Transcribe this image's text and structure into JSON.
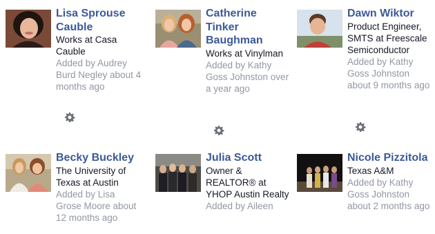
{
  "people": [
    {
      "name": "Lisa Sprouse Cauble",
      "work": "Works at Casa Cauble",
      "added": "Added by Audrey Burd Negley about 4 months ago"
    },
    {
      "name": "Catherine Tinker Baughman",
      "work": "Works at Vinylman",
      "added": "Added by Kathy Goss Johnston over a year ago"
    },
    {
      "name": "Dawn Wiktor",
      "work": "Product Engineer, SMTS at Freescale Semiconductor",
      "added": "Added by Kathy Goss Johnston about 9 months ago"
    },
    {
      "name": "Becky Buckley",
      "work": "The University of Texas at Austin",
      "added": "Added by Lisa Grose Moore about 12 months ago"
    },
    {
      "name": "Julia Scott",
      "work": "Owner & REALTOR® at YHOP Austin Realty",
      "added": "Added by Aileen"
    },
    {
      "name": "Nicole Pizzitola",
      "work": "Texas A&M",
      "added": "Added by Kathy Goss Johnston about 2 months ago"
    }
  ],
  "icons": {
    "settings": "gear-icon"
  },
  "colors": {
    "name_link": "#3b5998",
    "body_text": "#141823",
    "muted_text": "#9197a3",
    "gear": "#6b6f77"
  }
}
